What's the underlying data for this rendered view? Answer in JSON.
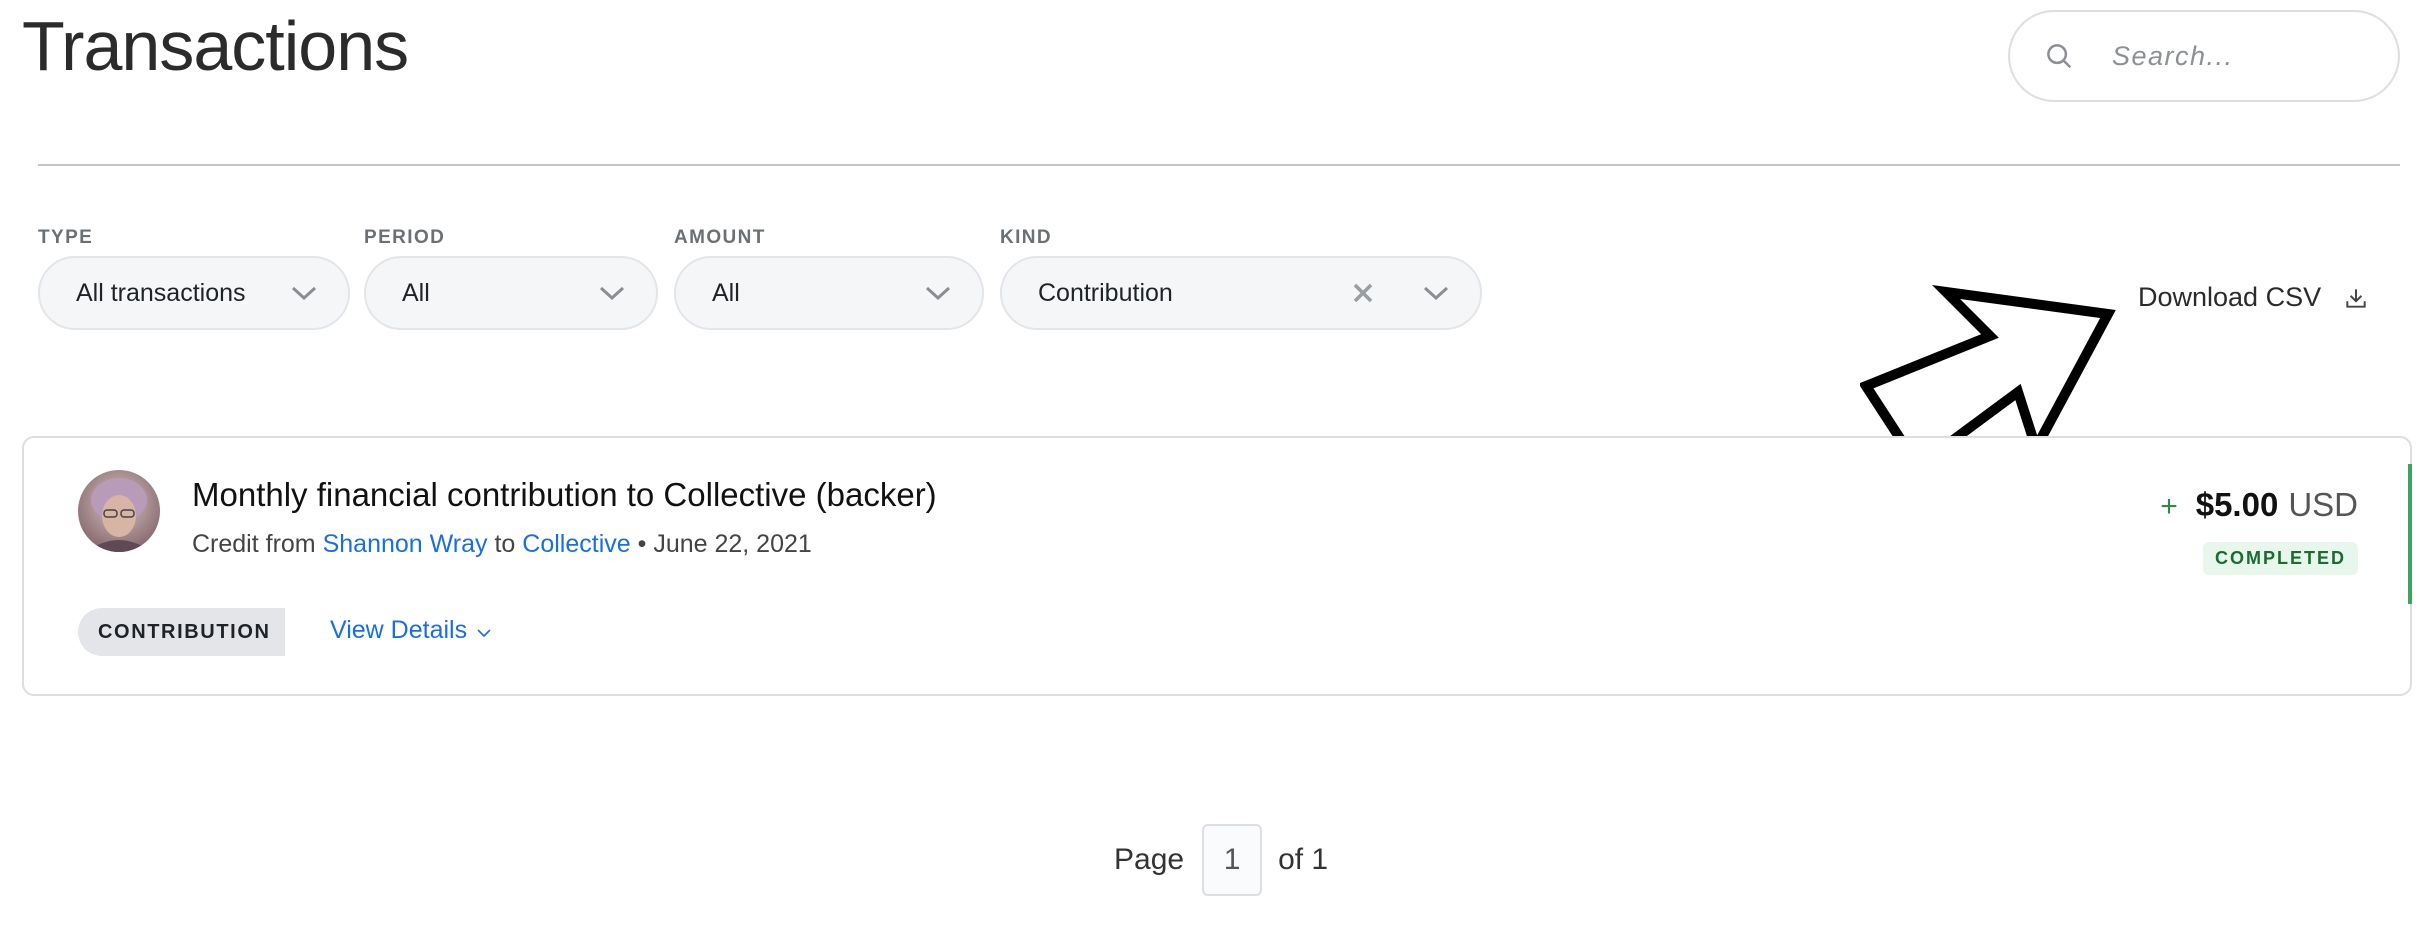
{
  "header": {
    "title": "Transactions",
    "search_placeholder": "Search..."
  },
  "filters": [
    {
      "label": "TYPE",
      "value": "All transactions"
    },
    {
      "label": "PERIOD",
      "value": "All"
    },
    {
      "label": "AMOUNT",
      "value": "All"
    },
    {
      "label": "KIND",
      "value": "Contribution"
    }
  ],
  "download": {
    "label": "Download CSV"
  },
  "transaction": {
    "title": "Monthly financial contribution to Collective (backer)",
    "credit_from_prefix": "Credit from",
    "from_name": "Shannon Wray",
    "to_word": "to",
    "to_name": "Collective",
    "separator": "•",
    "date": "June 22, 2021",
    "sign": "+",
    "amount": "$5.00",
    "currency": "USD",
    "status": "COMPLETED",
    "kind_tag": "CONTRIBUTION",
    "view_details": "View Details"
  },
  "pagination": {
    "page_word": "Page",
    "current": "1",
    "of_text": "of 1"
  },
  "colors": {
    "link": "#1a6fe0",
    "status_bg": "#e7f7ec",
    "status_text": "#1b6b32",
    "accent_green": "#3aa55d"
  }
}
